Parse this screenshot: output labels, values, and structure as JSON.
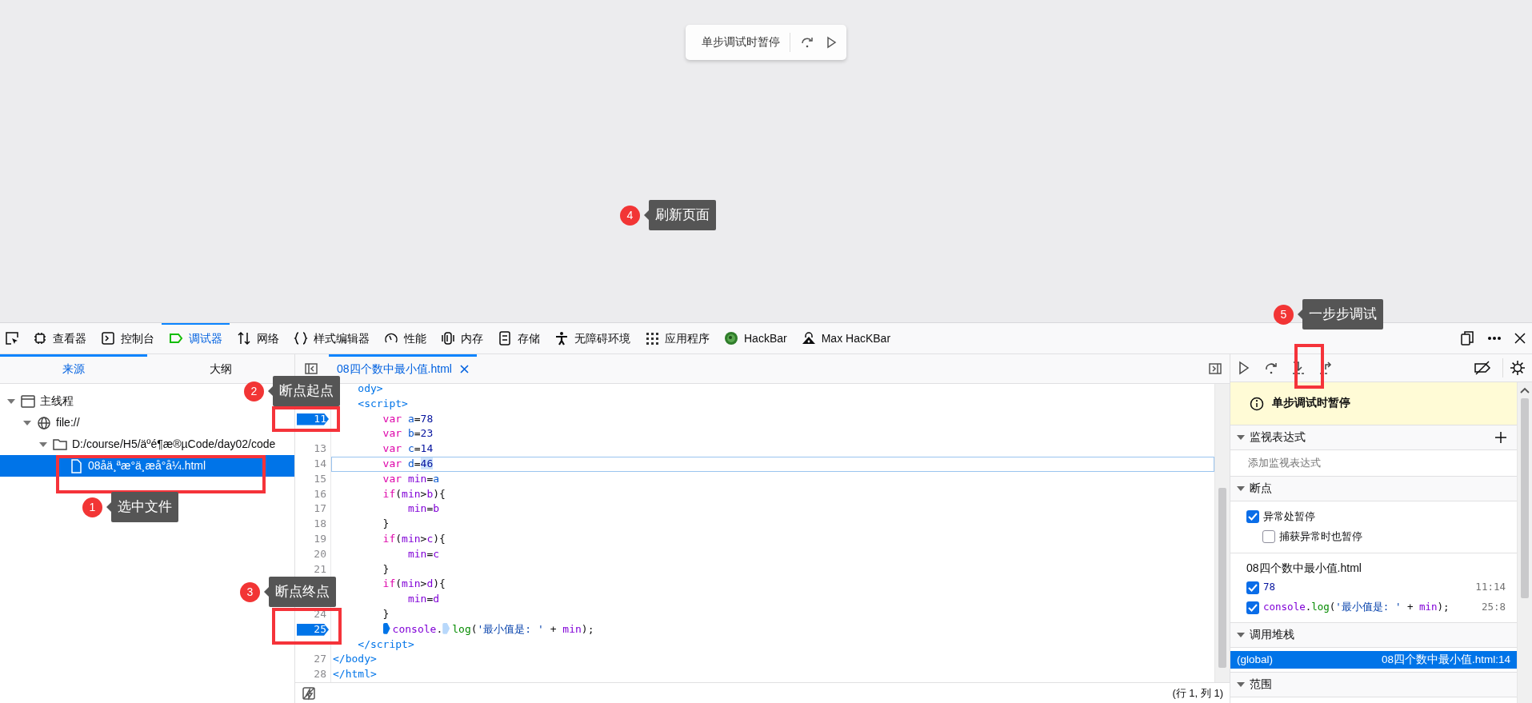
{
  "page": {
    "paused_overlay": {
      "label": "单步调试时暂停"
    }
  },
  "annotations": [
    {
      "number": "1",
      "text": "选中文件"
    },
    {
      "number": "2",
      "text": "断点起点"
    },
    {
      "number": "3",
      "text": "断点终点"
    },
    {
      "number": "4",
      "text": "刷新页面"
    },
    {
      "number": "5",
      "text": "一步步调试"
    }
  ],
  "toolbar": {
    "tabs": [
      {
        "label": "查看器",
        "selected": false
      },
      {
        "label": "控制台",
        "selected": false
      },
      {
        "label": "调试器",
        "selected": true
      },
      {
        "label": "网络",
        "selected": false
      },
      {
        "label": "样式编辑器",
        "selected": false
      },
      {
        "label": "性能",
        "selected": false
      },
      {
        "label": "内存",
        "selected": false
      },
      {
        "label": "存储",
        "selected": false
      },
      {
        "label": "无障碍环境",
        "selected": false
      },
      {
        "label": "应用程序",
        "selected": false
      },
      {
        "label": "HackBar",
        "selected": false
      },
      {
        "label": "Max HacKBar",
        "selected": false
      }
    ]
  },
  "sources_panel": {
    "tabs": [
      {
        "label": "来源",
        "selected": true
      },
      {
        "label": "大纲",
        "selected": false
      }
    ],
    "tree": [
      {
        "label": "主线程",
        "expanded": true,
        "selected": false,
        "children": [
          {
            "label": "file://",
            "expanded": true,
            "selected": false,
            "children": [
              {
                "label": "D:/course/H5/äºé¶æ®µCode/day02/code",
                "expanded": true,
                "selected": false,
                "children": [
                  {
                    "label": "08åä¸ªæ°ä¸æå°å¼.html",
                    "selected": true
                  }
                ]
              }
            ]
          }
        ]
      }
    ]
  },
  "editor": {
    "tab": {
      "label": "08四个数中最小值.html",
      "selected": true
    },
    "lines": [
      {
        "breakpoint": false,
        "paused": false,
        "tokens": [
          {
            "kind": "tag",
            "text": "    ody>"
          }
        ]
      },
      {
        "breakpoint": false,
        "paused": false,
        "tokens": [
          {
            "kind": "tag",
            "text": "    <script>"
          }
        ]
      },
      {
        "number": "11",
        "breakpoint": true,
        "paused": false,
        "tokens": [
          {
            "kind": "kw",
            "text": "        var "
          },
          {
            "kind": "def",
            "text": "a"
          },
          {
            "kind": "punc",
            "text": "="
          },
          {
            "kind": "num",
            "text": "78"
          }
        ]
      },
      {
        "breakpoint": false,
        "paused": false,
        "tokens": [
          {
            "kind": "kw",
            "text": "        var "
          },
          {
            "kind": "def",
            "text": "b"
          },
          {
            "kind": "punc",
            "text": "="
          },
          {
            "kind": "num",
            "text": "23"
          }
        ]
      },
      {
        "number": "13",
        "breakpoint": false,
        "paused": false,
        "tokens": [
          {
            "kind": "kw",
            "text": "        var "
          },
          {
            "kind": "def",
            "text": "c"
          },
          {
            "kind": "punc",
            "text": "="
          },
          {
            "kind": "num",
            "text": "14"
          }
        ]
      },
      {
        "number": "14",
        "breakpoint": false,
        "paused": true,
        "tokens": [
          {
            "kind": "kw",
            "text": "        var "
          },
          {
            "kind": "def",
            "text": "d"
          },
          {
            "kind": "punc",
            "text": "="
          },
          {
            "kind": "num",
            "text": "46",
            "highlighted": true
          }
        ]
      },
      {
        "number": "15",
        "breakpoint": false,
        "paused": false,
        "tokens": [
          {
            "kind": "kw",
            "text": "        var "
          },
          {
            "kind": "var",
            "text": "min"
          },
          {
            "kind": "punc",
            "text": "="
          },
          {
            "kind": "def",
            "text": "a"
          }
        ]
      },
      {
        "number": "16",
        "breakpoint": false,
        "paused": false,
        "tokens": [
          {
            "kind": "kw",
            "text": "        if"
          },
          {
            "kind": "punc",
            "text": "("
          },
          {
            "kind": "var",
            "text": "min"
          },
          {
            "kind": "punc",
            "text": ">"
          },
          {
            "kind": "var",
            "text": "b"
          },
          {
            "kind": "punc",
            "text": "){"
          }
        ]
      },
      {
        "number": "17",
        "breakpoint": false,
        "paused": false,
        "tokens": [
          {
            "kind": "var",
            "text": "            min"
          },
          {
            "kind": "punc",
            "text": "="
          },
          {
            "kind": "var",
            "text": "b"
          }
        ]
      },
      {
        "number": "18",
        "breakpoint": false,
        "paused": false,
        "tokens": [
          {
            "kind": "punc",
            "text": "        }"
          }
        ]
      },
      {
        "number": "19",
        "breakpoint": false,
        "paused": false,
        "tokens": [
          {
            "kind": "kw",
            "text": "        if"
          },
          {
            "kind": "punc",
            "text": "("
          },
          {
            "kind": "var",
            "text": "min"
          },
          {
            "kind": "punc",
            "text": ">"
          },
          {
            "kind": "var",
            "text": "c"
          },
          {
            "kind": "punc",
            "text": "){"
          }
        ]
      },
      {
        "number": "20",
        "breakpoint": false,
        "paused": false,
        "tokens": [
          {
            "kind": "var",
            "text": "            min"
          },
          {
            "kind": "punc",
            "text": "="
          },
          {
            "kind": "var",
            "text": "c"
          }
        ]
      },
      {
        "number": "21",
        "breakpoint": false,
        "paused": false,
        "tokens": [
          {
            "kind": "punc",
            "text": "        }"
          }
        ]
      },
      {
        "breakpoint": false,
        "paused": false,
        "tokens": [
          {
            "kind": "kw",
            "text": "        if"
          },
          {
            "kind": "punc",
            "text": "("
          },
          {
            "kind": "var",
            "text": "min"
          },
          {
            "kind": "punc",
            "text": ">"
          },
          {
            "kind": "var",
            "text": "d"
          },
          {
            "kind": "punc",
            "text": "){"
          }
        ]
      },
      {
        "breakpoint": false,
        "paused": false,
        "tokens": [
          {
            "kind": "var",
            "text": "            min"
          },
          {
            "kind": "punc",
            "text": "="
          },
          {
            "kind": "var",
            "text": "d"
          }
        ]
      },
      {
        "number": "24",
        "breakpoint": false,
        "paused": false,
        "tokens": [
          {
            "kind": "punc",
            "text": "        }"
          }
        ]
      },
      {
        "number": "25",
        "breakpoint": true,
        "paused": false,
        "tokens": [
          {
            "kind": "column_breakpoint",
            "on": true
          },
          {
            "kind": "var",
            "text": "console"
          },
          {
            "kind": "punc",
            "text": "."
          },
          {
            "kind": "column_breakpoint",
            "on": false
          },
          {
            "kind": "prop",
            "text": "log"
          },
          {
            "kind": "punc",
            "text": "("
          },
          {
            "kind": "str",
            "text": "'最小值是: '"
          },
          {
            "kind": "punc",
            "text": " + "
          },
          {
            "kind": "var",
            "text": "min"
          },
          {
            "kind": "punc",
            "text": ");"
          }
        ]
      },
      {
        "breakpoint": false,
        "paused": false,
        "tokens": [
          {
            "kind": "tag",
            "text": "    </script>"
          }
        ]
      },
      {
        "number": "27",
        "breakpoint": false,
        "paused": false,
        "tokens": [
          {
            "kind": "tag",
            "text": "</body>"
          }
        ]
      },
      {
        "number": "28",
        "breakpoint": false,
        "paused": false,
        "tokens": [
          {
            "kind": "tag",
            "text": "</html>"
          }
        ]
      }
    ],
    "status": "(行 1, 列 1)"
  },
  "debugger_panel": {
    "paused_banner": "单步调试时暂停",
    "watch": {
      "title": "监视表达式",
      "expanded": true,
      "placeholder": "添加监视表达式"
    },
    "breakpoints": {
      "title": "断点",
      "expanded": true,
      "options": [
        {
          "label": "异常处暂停",
          "checked": true
        },
        {
          "label": "捕获异常时也暂停",
          "checked": false
        }
      ],
      "file": "08四个数中最小值.html",
      "items": [
        {
          "checked": true,
          "tokens": [
            {
              "kind": "num",
              "text": "78"
            }
          ],
          "location": "11:14"
        },
        {
          "checked": true,
          "tokens": [
            {
              "kind": "var",
              "text": "console"
            },
            {
              "kind": "punc",
              "text": "."
            },
            {
              "kind": "prop",
              "text": "log"
            },
            {
              "kind": "punc",
              "text": "("
            },
            {
              "kind": "str",
              "text": "'最小值是: '"
            },
            {
              "kind": "punc",
              "text": " + "
            },
            {
              "kind": "var",
              "text": "min"
            },
            {
              "kind": "punc",
              "text": ");"
            }
          ],
          "location": "25:8"
        }
      ]
    },
    "call_stack": {
      "title": "调用堆栈",
      "expanded": true,
      "frames": [
        {
          "name": "(global)",
          "location": "08四个数中最小值.html:14",
          "selected": true
        }
      ]
    },
    "scopes": {
      "title": "范围",
      "expanded": true
    }
  }
}
